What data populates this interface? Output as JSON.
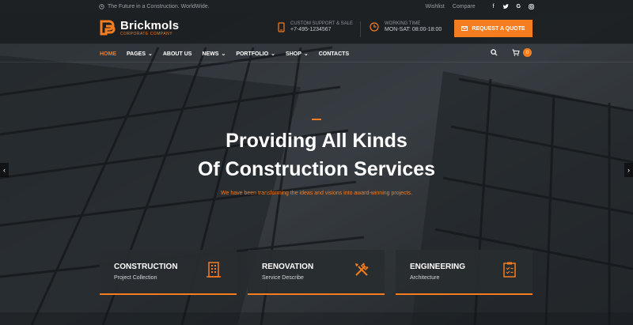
{
  "topbar": {
    "tagline": "The Future in a Construction. WorldWide.",
    "links": [
      "Wishlist",
      "Compare"
    ],
    "social": [
      "facebook-icon",
      "twitter-icon",
      "google-icon",
      "instagram-icon"
    ]
  },
  "header": {
    "brand": "Brickmols",
    "brand_sub": "CORPORATE COMPANY",
    "support_label": "CUSTOM SUPPORT & SALE",
    "support_value": "+7-495-1234567",
    "hours_label": "WORKING TIME",
    "hours_value": "MON-SAT: 08:00-18:00",
    "quote_button": "REQUEST A QUOTE"
  },
  "nav": {
    "items": [
      {
        "label": "HOME",
        "active": true,
        "dropdown": false
      },
      {
        "label": "PAGES",
        "active": false,
        "dropdown": true
      },
      {
        "label": "ABOUT US",
        "active": false,
        "dropdown": false
      },
      {
        "label": "NEWS",
        "active": false,
        "dropdown": true
      },
      {
        "label": "PORTFOLIO",
        "active": false,
        "dropdown": true
      },
      {
        "label": "SHOP",
        "active": false,
        "dropdown": true
      },
      {
        "label": "CONTACTS",
        "active": false,
        "dropdown": false
      }
    ],
    "cart_count": "0"
  },
  "hero": {
    "title_line1": "Providing All Kinds",
    "title_line2": "Of Construction Services",
    "subtitle": "We have been transforming the ideas and visions into award-winning projects."
  },
  "services": [
    {
      "title": "CONSTRUCTION",
      "desc": "Project Collection",
      "icon": "building-icon"
    },
    {
      "title": "RENOVATION",
      "desc": "Service Describe",
      "icon": "tools-icon"
    },
    {
      "title": "ENGINEERING",
      "desc": "Architecture",
      "icon": "checklist-icon"
    }
  ],
  "colors": {
    "accent": "#f57c1f",
    "dark": "#1e2124"
  }
}
